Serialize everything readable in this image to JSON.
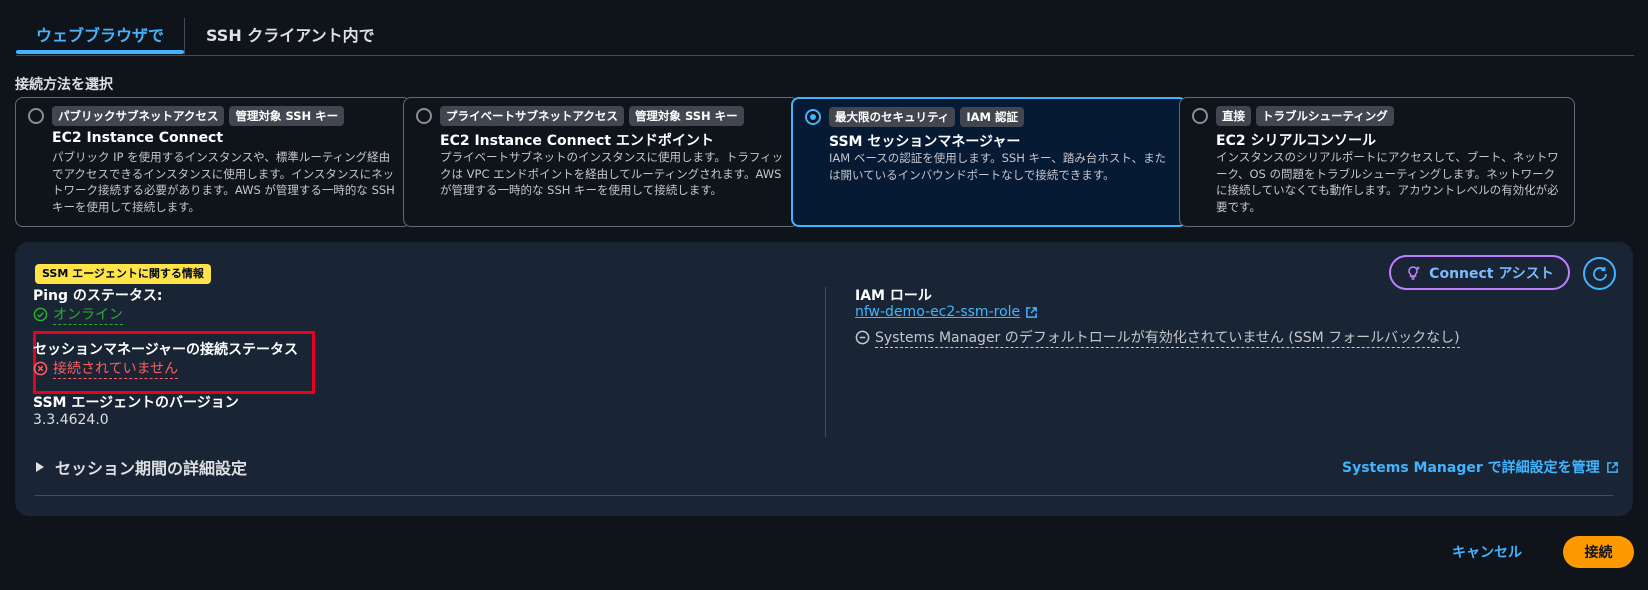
{
  "tabs": [
    {
      "label": "ウェブブラウザで",
      "active": true
    },
    {
      "label": "SSH クライアント内で",
      "active": false
    }
  ],
  "connect_method_label": "接続方法を選択",
  "options": [
    {
      "badges": [
        "パブリックサブネットアクセス",
        "管理対象 SSH キー"
      ],
      "title": "EC2 Instance Connect",
      "description": "パブリック IP を使用するインスタンスや、標準ルーティング経由でアクセスできるインスタンスに使用します。インスタンスにネットワーク接続する必要があります。AWS が管理する一時的な SSH キーを使用して接続します。",
      "selected": false
    },
    {
      "badges": [
        "プライベートサブネットアクセス",
        "管理対象 SSH キー"
      ],
      "title": "EC2 Instance Connect エンドポイント",
      "description": "プライベートサブネットのインスタンスに使用します。トラフィックは VPC エンドポイントを経由してルーティングされます。AWS が管理する一時的な SSH キーを使用して接続します。",
      "selected": false
    },
    {
      "badges": [
        "最大限のセキュリティ",
        "IAM 認証"
      ],
      "title": "SSM セッションマネージャー",
      "description": "IAM ベースの認証を使用します。SSH キー、踏み台ホスト、または開いているインバウンドポートなしで接続できます。",
      "selected": true
    },
    {
      "badges": [
        "直接",
        "トラブルシューティング"
      ],
      "title": "EC2 シリアルコンソール",
      "description": "インスタンスのシリアルポートにアクセスして、ブート、ネットワーク、OS の問題をトラブルシューティングします。ネットワークに接続していなくても動作します。アカウントレベルの有効化が必要です。",
      "selected": false
    }
  ],
  "ssm_panel": {
    "info_badge": "SSM エージェントに関する情報",
    "connect_assist_label": "Connect アシスト",
    "ping_status_label": "Ping のステータス:",
    "ping_status_value": "オンライン",
    "session_status_label": "セッションマネージャーの接続ステータス",
    "session_status_value": "接続されていません",
    "agent_version_label": "SSM エージェントのバージョン",
    "agent_version_value": "3.3.4624.0",
    "iam_role_label": "IAM ロール",
    "iam_role_value": "nfw-demo-ec2-ssm-role",
    "default_role_note": "Systems Manager のデフォルトロールが有効化されていません (SSM フォールバックなし)",
    "session_settings_label": "セッション期間の詳細設定",
    "manage_link": "Systems Manager で詳細設定を管理"
  },
  "footer": {
    "cancel_label": "キャンセル",
    "connect_label": "接続"
  },
  "colors": {
    "accent": "#42b4ff",
    "primary_button": "#ff9900",
    "success": "#29ad32",
    "error": "#ff5d64",
    "highlight": "#e8001c",
    "info_badge": "#ffe347"
  }
}
